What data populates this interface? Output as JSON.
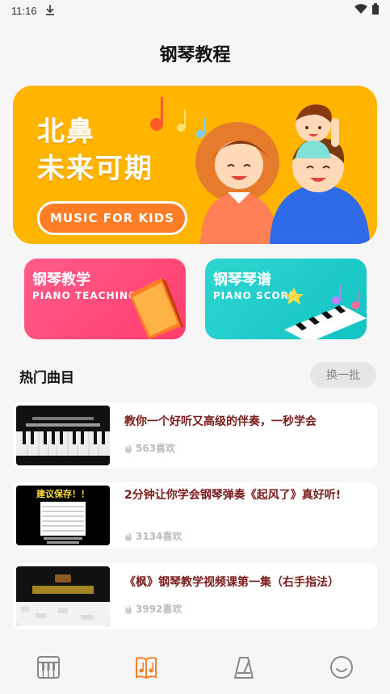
{
  "status": {
    "time": "11:16"
  },
  "page": {
    "title": "钢琴教程"
  },
  "hero": {
    "line1": "北鼻",
    "line2": "未来可期",
    "tagline": "MUSIC FOR KIDS"
  },
  "categories": [
    {
      "cn": "钢琴教学",
      "en": "PIANO TEACHING"
    },
    {
      "cn": "钢琴琴谱",
      "en": "PIANO SCORE"
    }
  ],
  "section": {
    "title": "热门曲目",
    "refresh_label": "换一批"
  },
  "songs": [
    {
      "title": "教你一个好听又高级的伴奏，一秒学会",
      "likes": "563喜欢"
    },
    {
      "title": "2分钟让你学会钢琴弹奏《起风了》真好听!",
      "likes": "3134喜欢",
      "thumb_text": "建议保存！！"
    },
    {
      "title": "《枫》钢琴教学视频课第一集（右手指法）",
      "likes": "3992喜欢"
    }
  ],
  "nav": [
    {
      "icon": "piano-icon"
    },
    {
      "icon": "music-book-icon"
    },
    {
      "icon": "metronome-icon"
    },
    {
      "icon": "smiley-icon"
    }
  ],
  "colors": {
    "accent": "#ff7d26",
    "hero_bg": "#ffb400",
    "teach_bg": "#ff4a76",
    "score_bg": "#1ecbc9",
    "song_title": "#7a1c1c"
  }
}
